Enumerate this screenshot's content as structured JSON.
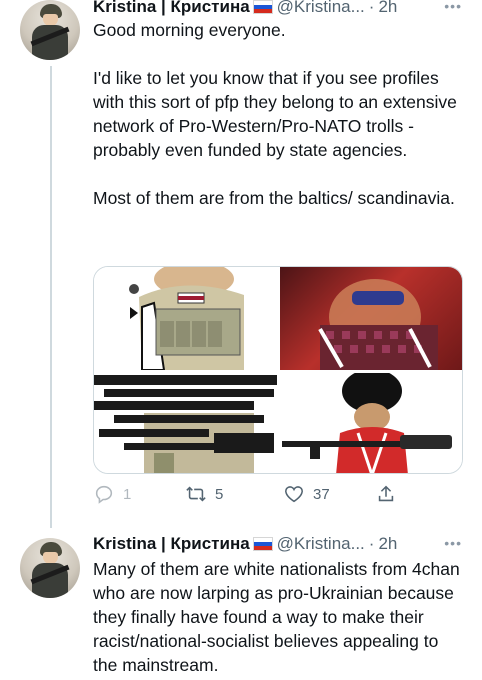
{
  "tweets": [
    {
      "name": "Kristina | Кристина",
      "handle": "@Kristina...",
      "separator": "·",
      "time": "2h",
      "more": "•••",
      "text": "Good morning everyone.\n\nI'd like to let you know that if you see profiles with this sort of pfp they belong to an extensive network of Pro-Western/Pro-NATO trolls - probably even funded by state agencies.\n\nMost of them are from the baltics/ scandinavia.",
      "stats": {
        "replies": "1",
        "retweets": "5",
        "likes": "37"
      }
    },
    {
      "name": "Kristina | Кристина",
      "handle": "@Kristina...",
      "separator": "·",
      "time": "2h",
      "more": "•••",
      "text": "Many of them are white nationalists from 4chan who are now larping as pro-Ukrainian because they finally have found a way to make their racist/national-socialist believes appealing to the mainstream."
    }
  ],
  "icons": [
    "reply-icon",
    "retweet-icon",
    "like-icon",
    "share-icon"
  ],
  "colors": {
    "text": "#0f1419",
    "secondary": "#536471",
    "border": "#cfd9de"
  }
}
